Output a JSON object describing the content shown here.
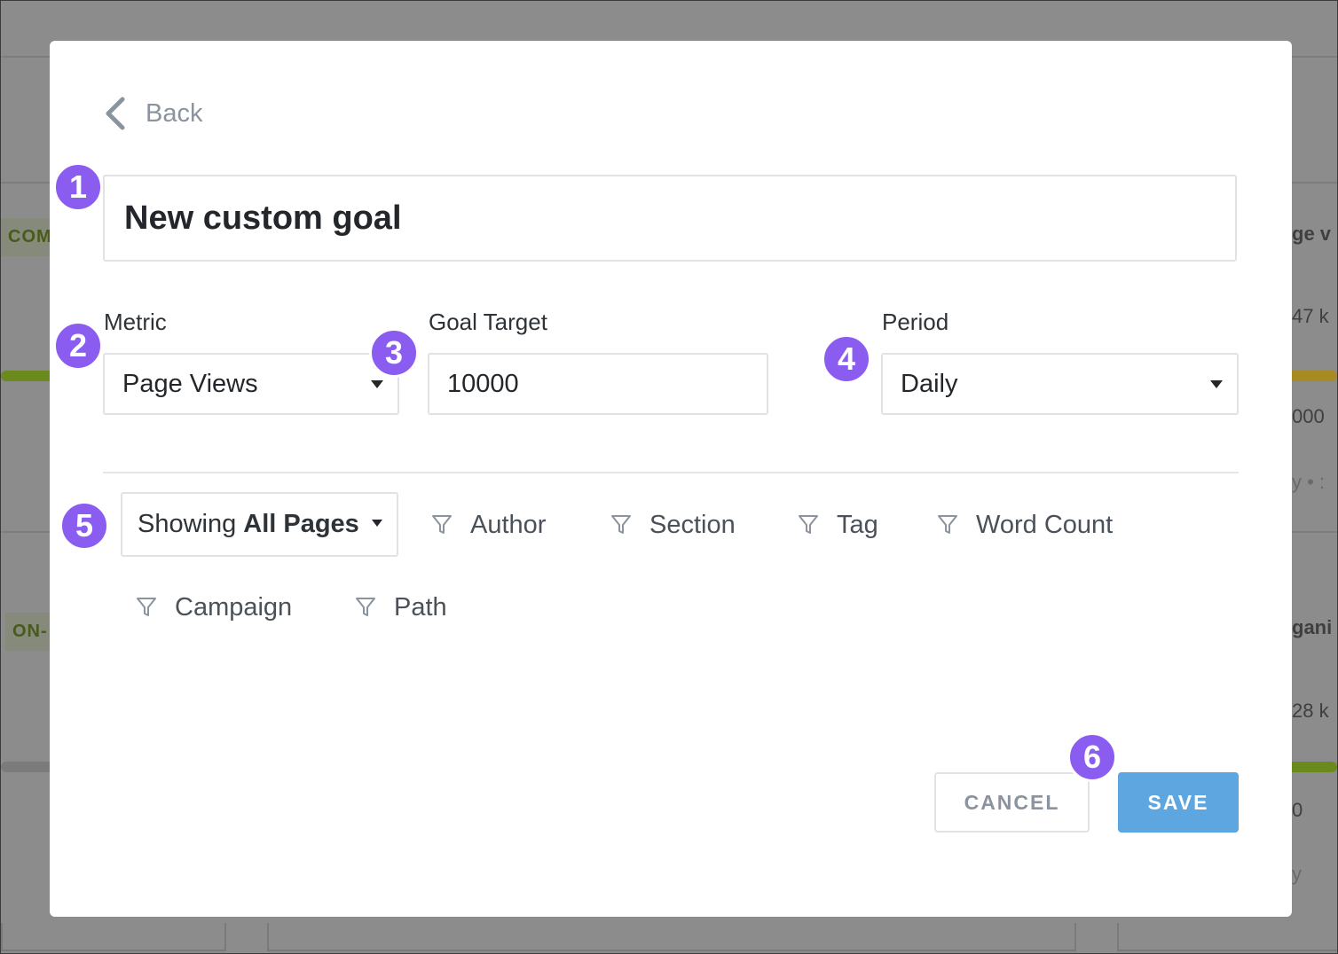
{
  "colors": {
    "badge": "#8a5cf0",
    "save_button": "#5ea6e0",
    "overlay": "#8c8c8c"
  },
  "background": {
    "tags": [
      "COM",
      "ON-"
    ],
    "right_fragments": [
      "ge v",
      "47 k",
      "000",
      "y • :",
      "gani",
      "28 k",
      "0",
      "y"
    ]
  },
  "modal": {
    "back_label": "Back",
    "goal_name": "New custom goal",
    "metric": {
      "label": "Metric",
      "value": "Page Views"
    },
    "goal_target": {
      "label": "Goal Target",
      "value": "10000"
    },
    "period": {
      "label": "Period",
      "value": "Daily"
    },
    "showing": {
      "prefix": "Showing",
      "value": "All Pages"
    },
    "filters": [
      "Author",
      "Section",
      "Tag",
      "Word Count",
      "Campaign",
      "Path"
    ],
    "filter_icon": "funnel-icon",
    "cancel_label": "CANCEL",
    "save_label": "SAVE"
  },
  "badges": [
    "1",
    "2",
    "3",
    "4",
    "5",
    "6"
  ]
}
